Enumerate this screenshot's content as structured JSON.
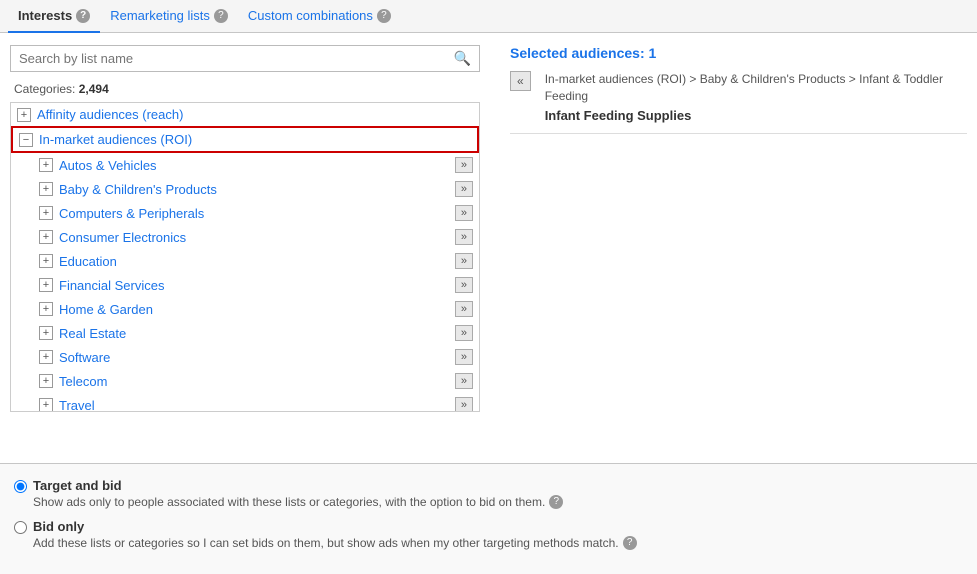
{
  "tabs": [
    {
      "id": "interests",
      "label": "Interests",
      "active": true
    },
    {
      "id": "remarketing",
      "label": "Remarketing lists",
      "active": false
    },
    {
      "id": "custom",
      "label": "Custom combinations",
      "active": false
    }
  ],
  "search": {
    "placeholder": "Search by list name"
  },
  "categories": {
    "label": "Categories:",
    "count": "2,494"
  },
  "categoryItems": [
    {
      "id": "affinity",
      "label": "Affinity audiences (reach)",
      "indent": 0,
      "hasArrow": false,
      "icon": "+"
    },
    {
      "id": "in-market",
      "label": "In-market audiences (ROI)",
      "indent": 0,
      "hasArrow": false,
      "icon": "−",
      "highlighted": true
    },
    {
      "id": "autos",
      "label": "Autos & Vehicles",
      "indent": 1,
      "hasArrow": true,
      "icon": "+"
    },
    {
      "id": "baby",
      "label": "Baby & Children's Products",
      "indent": 1,
      "hasArrow": true,
      "icon": "+"
    },
    {
      "id": "computers",
      "label": "Computers & Peripherals",
      "indent": 1,
      "hasArrow": true,
      "icon": "+"
    },
    {
      "id": "consumer",
      "label": "Consumer Electronics",
      "indent": 1,
      "hasArrow": true,
      "icon": "+"
    },
    {
      "id": "education",
      "label": "Education",
      "indent": 1,
      "hasArrow": true,
      "icon": "+"
    },
    {
      "id": "financial",
      "label": "Financial Services",
      "indent": 1,
      "hasArrow": true,
      "icon": "+"
    },
    {
      "id": "home",
      "label": "Home & Garden",
      "indent": 1,
      "hasArrow": true,
      "icon": "+"
    },
    {
      "id": "realestate",
      "label": "Real Estate",
      "indent": 1,
      "hasArrow": true,
      "icon": "+"
    },
    {
      "id": "software",
      "label": "Software",
      "indent": 1,
      "hasArrow": true,
      "icon": "+"
    },
    {
      "id": "telecom",
      "label": "Telecom",
      "indent": 1,
      "hasArrow": true,
      "icon": "+"
    },
    {
      "id": "travel",
      "label": "Travel",
      "indent": 1,
      "hasArrow": true,
      "icon": "+"
    }
  ],
  "selectedAudiences": {
    "title": "Selected audiences:",
    "count": "1",
    "backBtn": "«",
    "breadcrumb": "In-market audiences (ROI) > Baby & Children's Products > Infant & Toddler Feeding",
    "item": "Infant Feeding Supplies"
  },
  "bidOptions": [
    {
      "id": "target-bid",
      "label": "Target and bid",
      "description": "Show ads only to people associated with these lists or categories, with the option to bid on them.",
      "checked": true
    },
    {
      "id": "bid-only",
      "label": "Bid only",
      "description": "Add these lists or categories so I can set bids on them, but show ads when my other targeting methods match.",
      "checked": false
    }
  ]
}
